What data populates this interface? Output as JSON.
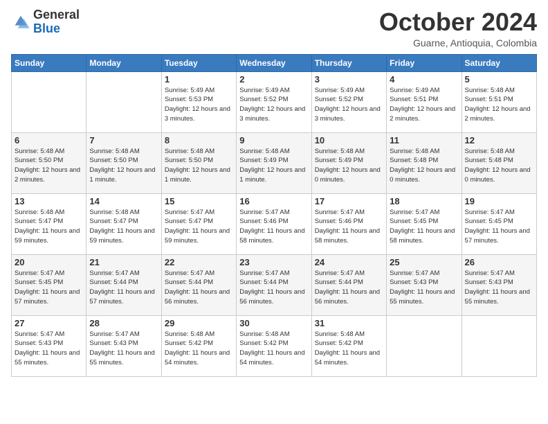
{
  "header": {
    "logo_general": "General",
    "logo_blue": "Blue",
    "month_title": "October 2024",
    "subtitle": "Guarne, Antioquia, Colombia"
  },
  "weekdays": [
    "Sunday",
    "Monday",
    "Tuesday",
    "Wednesday",
    "Thursday",
    "Friday",
    "Saturday"
  ],
  "weeks": [
    [
      {
        "day": "",
        "info": ""
      },
      {
        "day": "",
        "info": ""
      },
      {
        "day": "1",
        "info": "Sunrise: 5:49 AM\nSunset: 5:53 PM\nDaylight: 12 hours and 3 minutes."
      },
      {
        "day": "2",
        "info": "Sunrise: 5:49 AM\nSunset: 5:52 PM\nDaylight: 12 hours and 3 minutes."
      },
      {
        "day": "3",
        "info": "Sunrise: 5:49 AM\nSunset: 5:52 PM\nDaylight: 12 hours and 3 minutes."
      },
      {
        "day": "4",
        "info": "Sunrise: 5:49 AM\nSunset: 5:51 PM\nDaylight: 12 hours and 2 minutes."
      },
      {
        "day": "5",
        "info": "Sunrise: 5:48 AM\nSunset: 5:51 PM\nDaylight: 12 hours and 2 minutes."
      }
    ],
    [
      {
        "day": "6",
        "info": "Sunrise: 5:48 AM\nSunset: 5:50 PM\nDaylight: 12 hours and 2 minutes."
      },
      {
        "day": "7",
        "info": "Sunrise: 5:48 AM\nSunset: 5:50 PM\nDaylight: 12 hours and 1 minute."
      },
      {
        "day": "8",
        "info": "Sunrise: 5:48 AM\nSunset: 5:50 PM\nDaylight: 12 hours and 1 minute."
      },
      {
        "day": "9",
        "info": "Sunrise: 5:48 AM\nSunset: 5:49 PM\nDaylight: 12 hours and 1 minute."
      },
      {
        "day": "10",
        "info": "Sunrise: 5:48 AM\nSunset: 5:49 PM\nDaylight: 12 hours and 0 minutes."
      },
      {
        "day": "11",
        "info": "Sunrise: 5:48 AM\nSunset: 5:48 PM\nDaylight: 12 hours and 0 minutes."
      },
      {
        "day": "12",
        "info": "Sunrise: 5:48 AM\nSunset: 5:48 PM\nDaylight: 12 hours and 0 minutes."
      }
    ],
    [
      {
        "day": "13",
        "info": "Sunrise: 5:48 AM\nSunset: 5:47 PM\nDaylight: 11 hours and 59 minutes."
      },
      {
        "day": "14",
        "info": "Sunrise: 5:48 AM\nSunset: 5:47 PM\nDaylight: 11 hours and 59 minutes."
      },
      {
        "day": "15",
        "info": "Sunrise: 5:47 AM\nSunset: 5:47 PM\nDaylight: 11 hours and 59 minutes."
      },
      {
        "day": "16",
        "info": "Sunrise: 5:47 AM\nSunset: 5:46 PM\nDaylight: 11 hours and 58 minutes."
      },
      {
        "day": "17",
        "info": "Sunrise: 5:47 AM\nSunset: 5:46 PM\nDaylight: 11 hours and 58 minutes."
      },
      {
        "day": "18",
        "info": "Sunrise: 5:47 AM\nSunset: 5:45 PM\nDaylight: 11 hours and 58 minutes."
      },
      {
        "day": "19",
        "info": "Sunrise: 5:47 AM\nSunset: 5:45 PM\nDaylight: 11 hours and 57 minutes."
      }
    ],
    [
      {
        "day": "20",
        "info": "Sunrise: 5:47 AM\nSunset: 5:45 PM\nDaylight: 11 hours and 57 minutes."
      },
      {
        "day": "21",
        "info": "Sunrise: 5:47 AM\nSunset: 5:44 PM\nDaylight: 11 hours and 57 minutes."
      },
      {
        "day": "22",
        "info": "Sunrise: 5:47 AM\nSunset: 5:44 PM\nDaylight: 11 hours and 56 minutes."
      },
      {
        "day": "23",
        "info": "Sunrise: 5:47 AM\nSunset: 5:44 PM\nDaylight: 11 hours and 56 minutes."
      },
      {
        "day": "24",
        "info": "Sunrise: 5:47 AM\nSunset: 5:44 PM\nDaylight: 11 hours and 56 minutes."
      },
      {
        "day": "25",
        "info": "Sunrise: 5:47 AM\nSunset: 5:43 PM\nDaylight: 11 hours and 55 minutes."
      },
      {
        "day": "26",
        "info": "Sunrise: 5:47 AM\nSunset: 5:43 PM\nDaylight: 11 hours and 55 minutes."
      }
    ],
    [
      {
        "day": "27",
        "info": "Sunrise: 5:47 AM\nSunset: 5:43 PM\nDaylight: 11 hours and 55 minutes."
      },
      {
        "day": "28",
        "info": "Sunrise: 5:47 AM\nSunset: 5:43 PM\nDaylight: 11 hours and 55 minutes."
      },
      {
        "day": "29",
        "info": "Sunrise: 5:48 AM\nSunset: 5:42 PM\nDaylight: 11 hours and 54 minutes."
      },
      {
        "day": "30",
        "info": "Sunrise: 5:48 AM\nSunset: 5:42 PM\nDaylight: 11 hours and 54 minutes."
      },
      {
        "day": "31",
        "info": "Sunrise: 5:48 AM\nSunset: 5:42 PM\nDaylight: 11 hours and 54 minutes."
      },
      {
        "day": "",
        "info": ""
      },
      {
        "day": "",
        "info": ""
      }
    ]
  ]
}
